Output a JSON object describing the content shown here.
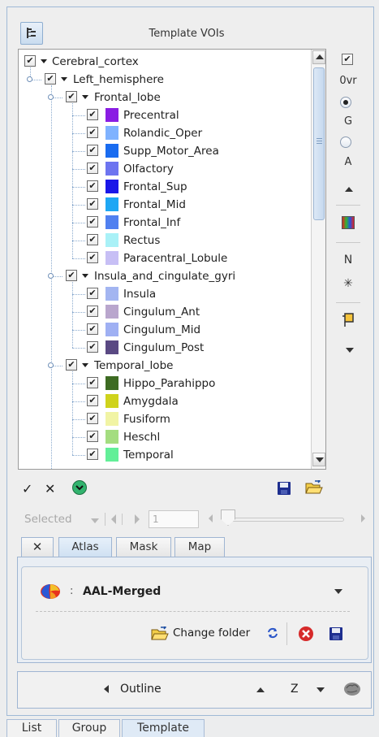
{
  "header": {
    "title": "Template VOIs",
    "layout_icon": "layout-toggle-icon"
  },
  "tree": {
    "nodes": [
      {
        "id": "cerebral",
        "label": "Cerebral_cortex",
        "level": 0,
        "checked": true,
        "expanded": true
      },
      {
        "id": "left-hemi",
        "label": "Left_hemisphere",
        "level": 1,
        "checked": true,
        "expanded": true
      },
      {
        "id": "frontal",
        "label": "Frontal_lobe",
        "level": 2,
        "checked": true,
        "expanded": true
      },
      {
        "id": "precentral",
        "label": "Precentral",
        "level": 3,
        "checked": true,
        "color": "#8a1de3"
      },
      {
        "id": "rolandic",
        "label": "Rolandic_Oper",
        "level": 3,
        "checked": true,
        "color": "#7fb2ff"
      },
      {
        "id": "supp-motor",
        "label": "Supp_Motor_Area",
        "level": 3,
        "checked": true,
        "color": "#1a6cf0"
      },
      {
        "id": "olfactory",
        "label": "Olfactory",
        "level": 3,
        "checked": true,
        "color": "#6d74f0"
      },
      {
        "id": "frontal-sup",
        "label": "Frontal_Sup",
        "level": 3,
        "checked": true,
        "color": "#1a17e8"
      },
      {
        "id": "frontal-mid",
        "label": "Frontal_Mid",
        "level": 3,
        "checked": true,
        "color": "#1ea7f4"
      },
      {
        "id": "frontal-inf",
        "label": "Frontal_Inf",
        "level": 3,
        "checked": true,
        "color": "#5080f0"
      },
      {
        "id": "rectus",
        "label": "Rectus",
        "level": 3,
        "checked": true,
        "color": "#a9f1f7"
      },
      {
        "id": "paracentral",
        "label": "Paracentral_Lobule",
        "level": 3,
        "checked": true,
        "color": "#c7bff5"
      },
      {
        "id": "insula-cing",
        "label": "Insula_and_cingulate_gyri",
        "level": 2,
        "checked": true,
        "expanded": true
      },
      {
        "id": "insula",
        "label": "Insula",
        "level": 3,
        "checked": true,
        "color": "#a3b5f1"
      },
      {
        "id": "cing-ant",
        "label": "Cingulum_Ant",
        "level": 3,
        "checked": true,
        "color": "#b9a6cd"
      },
      {
        "id": "cing-mid",
        "label": "Cingulum_Mid",
        "level": 3,
        "checked": true,
        "color": "#9fb0f3"
      },
      {
        "id": "cing-post",
        "label": "Cingulum_Post",
        "level": 3,
        "checked": true,
        "color": "#5a4983"
      },
      {
        "id": "temporal",
        "label": "Temporal_lobe",
        "level": 2,
        "checked": true,
        "expanded": true
      },
      {
        "id": "hippo",
        "label": "Hippo_Parahippo",
        "level": 3,
        "checked": true,
        "color": "#3d6b22"
      },
      {
        "id": "amygdala",
        "label": "Amygdala",
        "level": 3,
        "checked": true,
        "color": "#cfd31c"
      },
      {
        "id": "fusiform",
        "label": "Fusiform",
        "level": 3,
        "checked": true,
        "color": "#f1f4a4"
      },
      {
        "id": "heschl",
        "label": "Heschl",
        "level": 3,
        "checked": true,
        "color": "#a4dd80"
      },
      {
        "id": "temporal-leaf",
        "label": "Temporal",
        "level": 3,
        "checked": true,
        "color": "#63ef98"
      }
    ]
  },
  "side_controls": {
    "ovr_checked": true,
    "ovr_label": "0vr",
    "g_label": "G",
    "a_label": "A",
    "g_selected": true,
    "n_label": "N",
    "star_label": "✳"
  },
  "actions": {
    "check_all": "✓",
    "uncheck_all": "✕"
  },
  "navigation": {
    "selected_label": "Selected",
    "frame_value": "1"
  },
  "tabs": {
    "remove": "✕",
    "items": [
      "Atlas",
      "Mask",
      "Map"
    ],
    "active": "Atlas"
  },
  "atlas": {
    "separator": ":",
    "name": "AAL-Merged",
    "change_folder_label": "Change folder"
  },
  "outline_bar": {
    "outline_label": "Outline",
    "axis_label": "Z"
  },
  "bottom_tabs": {
    "items": [
      "List",
      "Group",
      "Template"
    ],
    "active": "Template"
  }
}
